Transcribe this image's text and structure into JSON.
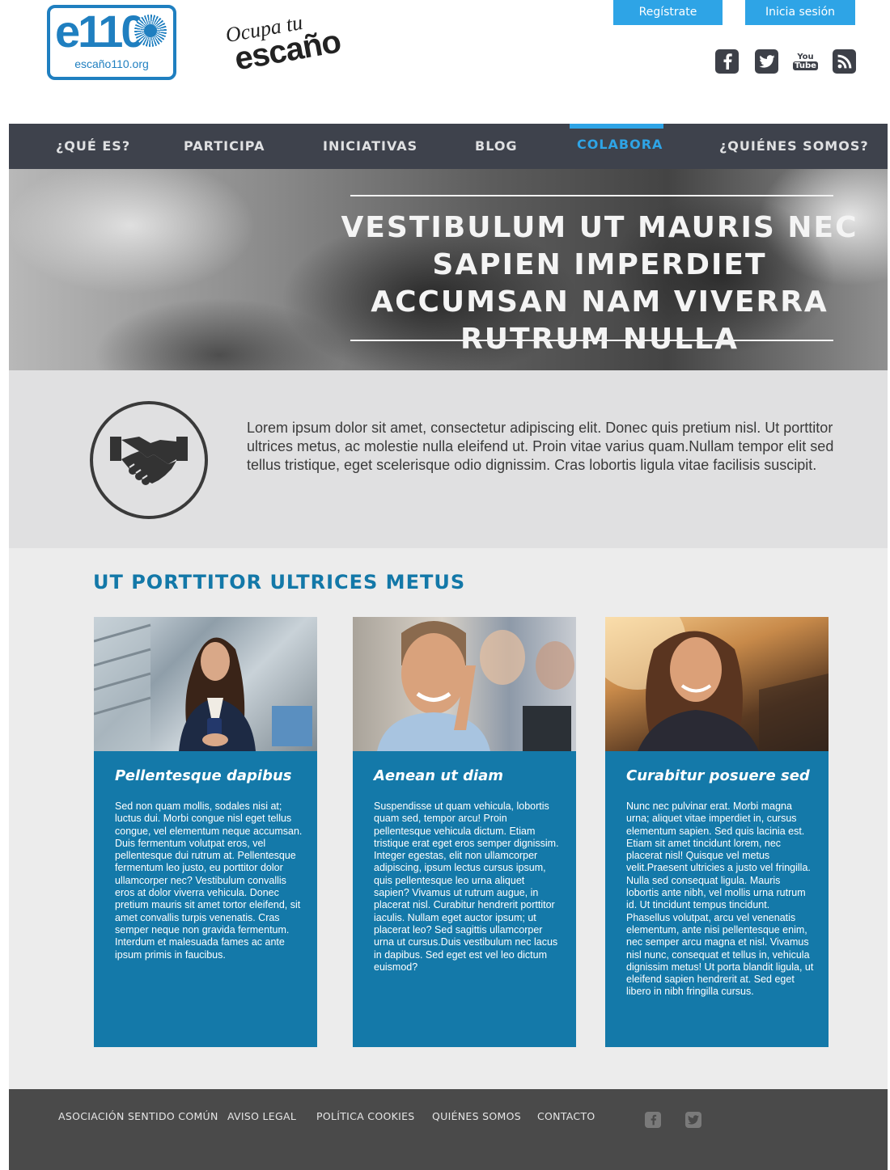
{
  "brand": {
    "logo_text": "e110",
    "logo_url": "escaño110.org",
    "campaign_line1": "Ocupa tu",
    "campaign_line2": "escaño"
  },
  "auth": {
    "register_label": "Regístrate",
    "login_label": "Inicia sesión"
  },
  "social_top": [
    "facebook-icon",
    "twitter-icon",
    "youtube-icon",
    "rss-icon"
  ],
  "youtube_icon_text": {
    "you": "You",
    "tube": "Tube"
  },
  "nav": {
    "items": [
      {
        "label": "¿QUÉ ES?"
      },
      {
        "label": "PARTICIPA"
      },
      {
        "label": "INICIATIVAS"
      },
      {
        "label": "BLOG"
      },
      {
        "label": "COLABORA"
      },
      {
        "label": "¿QUIÉNES SOMOS?"
      }
    ],
    "active": "COLABORA"
  },
  "hero": {
    "title": "VESTIBULUM UT MAURIS NEC SAPIEN IMPERDIET ACCUMSAN NAM VIVERRA RUTRUM NULLA"
  },
  "intro": {
    "icon": "handshake-icon",
    "text": "Lorem ipsum dolor sit amet, consectetur adipiscing elit. Donec quis pretium nisl. Ut porttitor ultrices metus, ac molestie nulla eleifend ut. Proin vitae varius quam.Nullam tempor elit sed tellus tristique, eget scelerisque odio dignissim. Cras lobortis ligula vitae facilisis suscipit."
  },
  "section": {
    "title": "UT PORTTITOR ULTRICES METUS",
    "cards": [
      {
        "title": "Pellentesque dapibus",
        "body": "Sed non quam mollis, sodales nisi at; luctus dui. Morbi congue nisl eget tellus congue, vel elementum neque accumsan. Duis fermentum volutpat eros, vel pellentesque dui rutrum at. Pellentesque fermentum leo justo, eu porttitor dolor ullamcorper nec? Vestibulum convallis eros at dolor viverra vehicula. Donec pretium mauris sit amet tortor eleifend, sit amet convallis turpis venenatis. Cras semper neque non gravida fermentum. Interdum et malesuada fames ac ante ipsum primis in faucibus."
      },
      {
        "title": "Aenean ut diam",
        "body": "Suspendisse ut quam vehicula, lobortis quam sed, tempor arcu! Proin pellentesque vehicula dictum. Etiam tristique erat eget eros semper dignissim. Integer egestas, elit non ullamcorper adipiscing, ipsum lectus cursus ipsum, quis pellentesque leo urna aliquet sapien? Vivamus ut rutrum augue, in placerat nisl. Curabitur hendrerit porttitor iaculis. Nullam eget auctor ipsum; ut placerat leo? Sed sagittis ullamcorper urna ut cursus.Duis vestibulum nec lacus in dapibus. Sed eget est vel leo dictum euismod?"
      },
      {
        "title": "Curabitur posuere sed",
        "body": "Nunc nec pulvinar erat. Morbi magna urna; aliquet vitae imperdiet in, cursus elementum sapien. Sed quis lacinia est. Etiam sit amet tincidunt lorem, nec placerat nisl! Quisque vel metus velit.Praesent ultricies a justo vel fringilla. Nulla sed consequat ligula. Mauris lobortis ante nibh, vel mollis urna rutrum id. Ut tincidunt tempus tincidunt. Phasellus volutpat, arcu vel venenatis elementum, ante nisi pellentesque enim, nec semper arcu magna et nisl. Vivamus nisl nunc, consequat et tellus in, vehicula dignissim metus! Ut porta blandit ligula, ut eleifend sapien hendrerit at. Sed eget libero in nibh fringilla cursus."
      }
    ]
  },
  "footer": {
    "links": [
      {
        "label": "ASOCIACIÓN SENTIDO COMÚN"
      },
      {
        "label": "AVISO LEGAL"
      },
      {
        "label": "POLÍTICA COOKIES"
      },
      {
        "label": "QUIÉNES SOMOS"
      },
      {
        "label": "CONTACTO"
      }
    ],
    "social": [
      "facebook-icon",
      "twitter-icon"
    ]
  },
  "colors": {
    "accent": "#2ea4e6",
    "nav_bg": "#3e424c",
    "card_bg": "#1479a9",
    "section_title": "#1378a8",
    "footer_bg": "#4a4a4a"
  }
}
